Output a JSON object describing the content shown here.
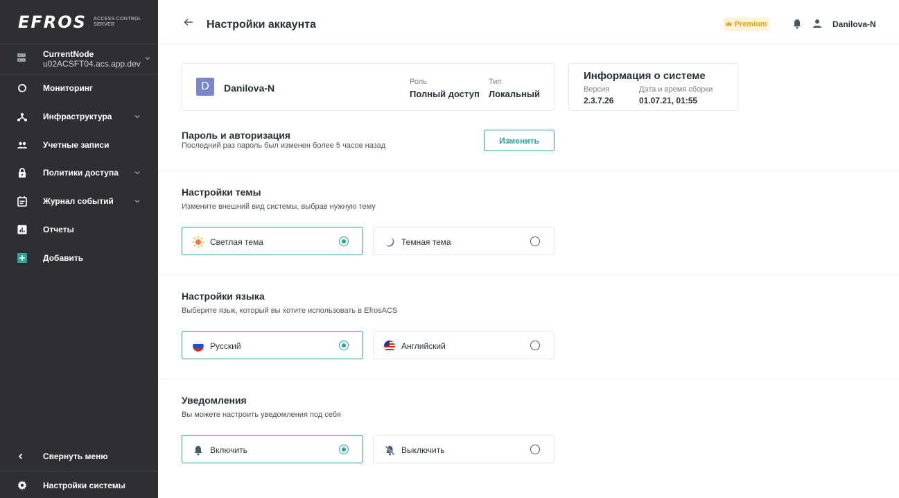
{
  "sidebar": {
    "logo_text": "EFROS",
    "logo_sub_1": "ACCESS CONTROL",
    "logo_sub_2": "SERVER",
    "node_name": "CurrentNode",
    "node_host": "u02ACSFT04.acs.app.dev",
    "items": [
      {
        "label": "Мониторинг"
      },
      {
        "label": "Инфраструктура"
      },
      {
        "label": "Учетные записи"
      },
      {
        "label": "Политики доступа"
      },
      {
        "label": "Журнал событий"
      },
      {
        "label": "Отчеты"
      },
      {
        "label": "Добавить"
      }
    ],
    "collapse_label": "Свернуть меню",
    "settings_label": "Настройки системы"
  },
  "header": {
    "title": "Настройки аккаунта",
    "premium_label": "Premium",
    "user_name": "Danilova-N"
  },
  "account": {
    "avatar_letter": "D",
    "name": "Danilova-N",
    "role_label": "Роль",
    "role_value": "Полный доступ",
    "type_label": "Тип",
    "type_value": "Локальный"
  },
  "system_info": {
    "title": "Информация о системе",
    "version_label": "Версия",
    "version_value": "2.3.7.26",
    "build_label": "Дата и время сборки",
    "build_value": "01.07.21, 01:55"
  },
  "password": {
    "title": "Пароль и авторизация",
    "subtitle": "Последний раз пароль был изменен более 5 часов назад",
    "button": "Изменить"
  },
  "theme": {
    "title": "Настройки темы",
    "subtitle": "Измените внешний вид системы, выбрав нужную тему",
    "options": [
      {
        "label": "Светлая тема",
        "selected": true
      },
      {
        "label": "Темная тема",
        "selected": false
      }
    ]
  },
  "language": {
    "title": "Настройки языка",
    "subtitle": "Выберите язык, который вы хотите использовать в EfrosACS",
    "options": [
      {
        "label": "Русский",
        "selected": true
      },
      {
        "label": "Английский",
        "selected": false
      }
    ]
  },
  "notifications": {
    "title": "Уведомления",
    "subtitle": "Вы можете настроить уведомления под себя",
    "options": [
      {
        "label": "Включить",
        "selected": true
      },
      {
        "label": "Выключить",
        "selected": false
      }
    ]
  },
  "colors": {
    "sidebar_bg": "#2d2f33",
    "accent": "#26a69a",
    "premium": "#e8a317",
    "avatar": "#7986cb"
  }
}
